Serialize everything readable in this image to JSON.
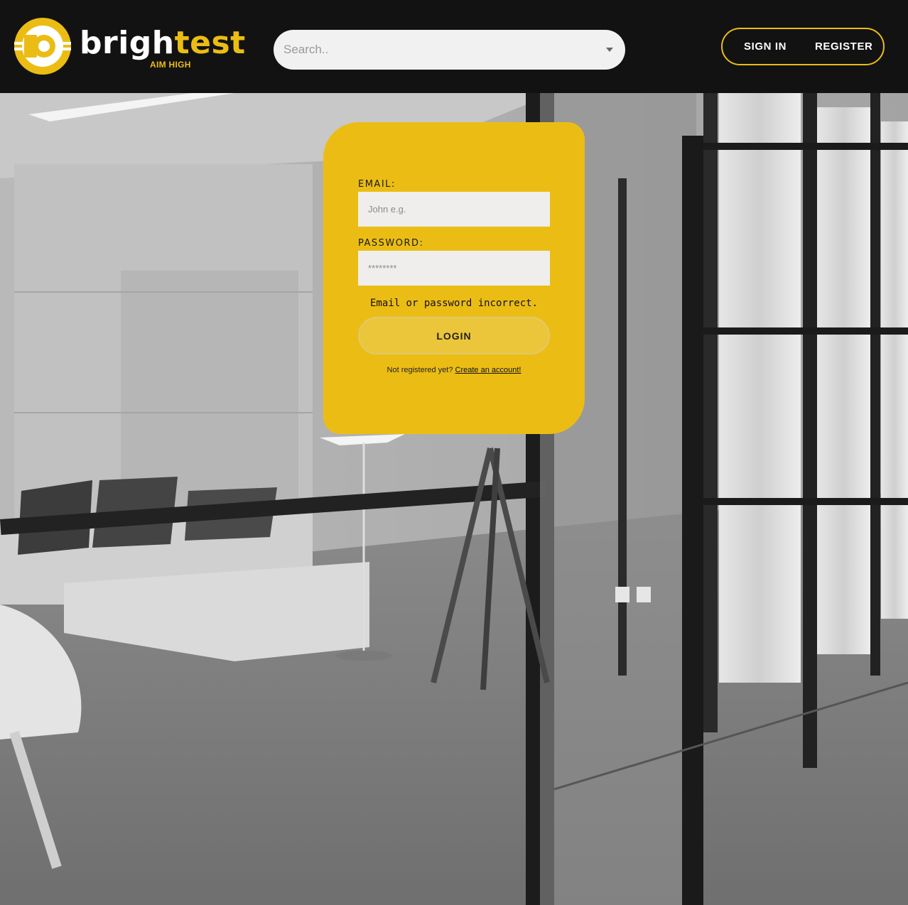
{
  "header": {
    "brand_white": "brigh",
    "brand_yellow": "test",
    "tagline": "AIM HIGH",
    "search_placeholder": "Search..",
    "sign_in_label": "SIGN IN",
    "register_label": "REGISTER"
  },
  "login": {
    "email_label": "EMAIL:",
    "email_placeholder": "John e.g.",
    "password_label": "PASSWORD:",
    "password_placeholder": "********",
    "error_message": "Email or password incorrect.",
    "login_button": "LOGIN",
    "signup_prompt": "Not registered yet?",
    "signup_link": "Create an account!"
  },
  "colors": {
    "accent": "#ebbd14",
    "header_bg": "#121212",
    "input_bg": "#efeeed"
  }
}
